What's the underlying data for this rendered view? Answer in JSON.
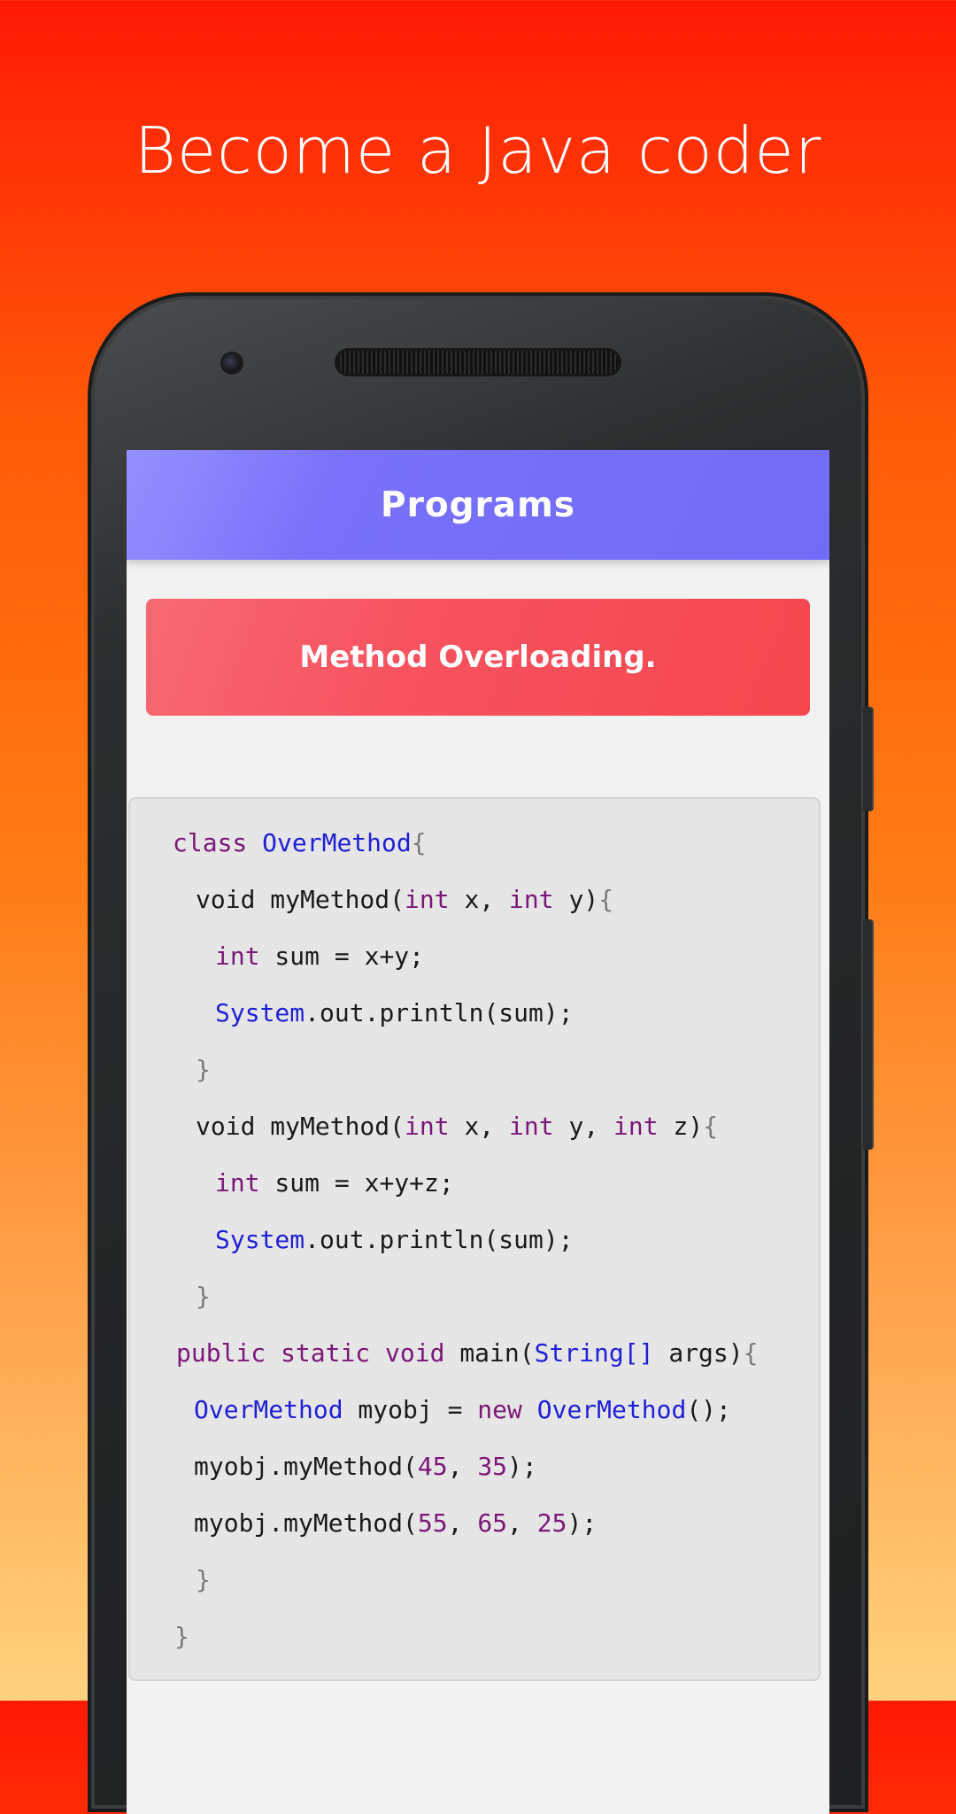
{
  "promo": {
    "headline": "Become a Java coder"
  },
  "app": {
    "title": "Programs",
    "topic": "Method Overloading."
  },
  "code": {
    "l1": {
      "kw": "class",
      "cls": "OverMethod",
      "brace": "{"
    },
    "l2": {
      "a": "void myMethod(",
      "kw1": "int",
      "b": " x, ",
      "kw2": "int",
      "c": " y)",
      "brace": "{"
    },
    "l3": {
      "kw": "int",
      "a": " sum = x+y;"
    },
    "l4": {
      "cls": "System",
      "a": ".out.println(sum);"
    },
    "l5": {
      "brace": "}"
    },
    "l6": {
      "a": "void myMethod(",
      "kw1": "int",
      "b": " x, ",
      "kw2": "int",
      "c": " y, ",
      "kw3": "int",
      "d": " z)",
      "brace": "{"
    },
    "l7": {
      "kw": "int",
      "a": " sum = x+y+z;"
    },
    "l8": {
      "cls": "System",
      "a": ".out.println(sum);"
    },
    "l9": {
      "brace": "}"
    },
    "l10": {
      "kw1": "public",
      "kw2": "static",
      "kw3": "void",
      "a": " main(",
      "cls": "String[]",
      "b": " args)",
      "brace": "{"
    },
    "l11": {
      "cls1": "OverMethod",
      "a": " myobj = ",
      "kw": "new",
      "cls2": "OverMethod",
      "b": "();"
    },
    "l12": {
      "a": "myobj.myMethod(",
      "n1": "45",
      "b": ", ",
      "n2": "35",
      "c": ");"
    },
    "l13": {
      "a": "myobj.myMethod(",
      "n1": "55",
      "b": ", ",
      "n2": "65",
      "c": ", ",
      "n3": "25",
      "d": ");"
    },
    "l14": {
      "brace": "}"
    },
    "l15": {
      "brace": "}"
    }
  },
  "colors": {
    "keyword": "#7b1777",
    "class_name": "#1f1fd6",
    "appbar": "#716cf7",
    "banner": "#f5474f"
  }
}
